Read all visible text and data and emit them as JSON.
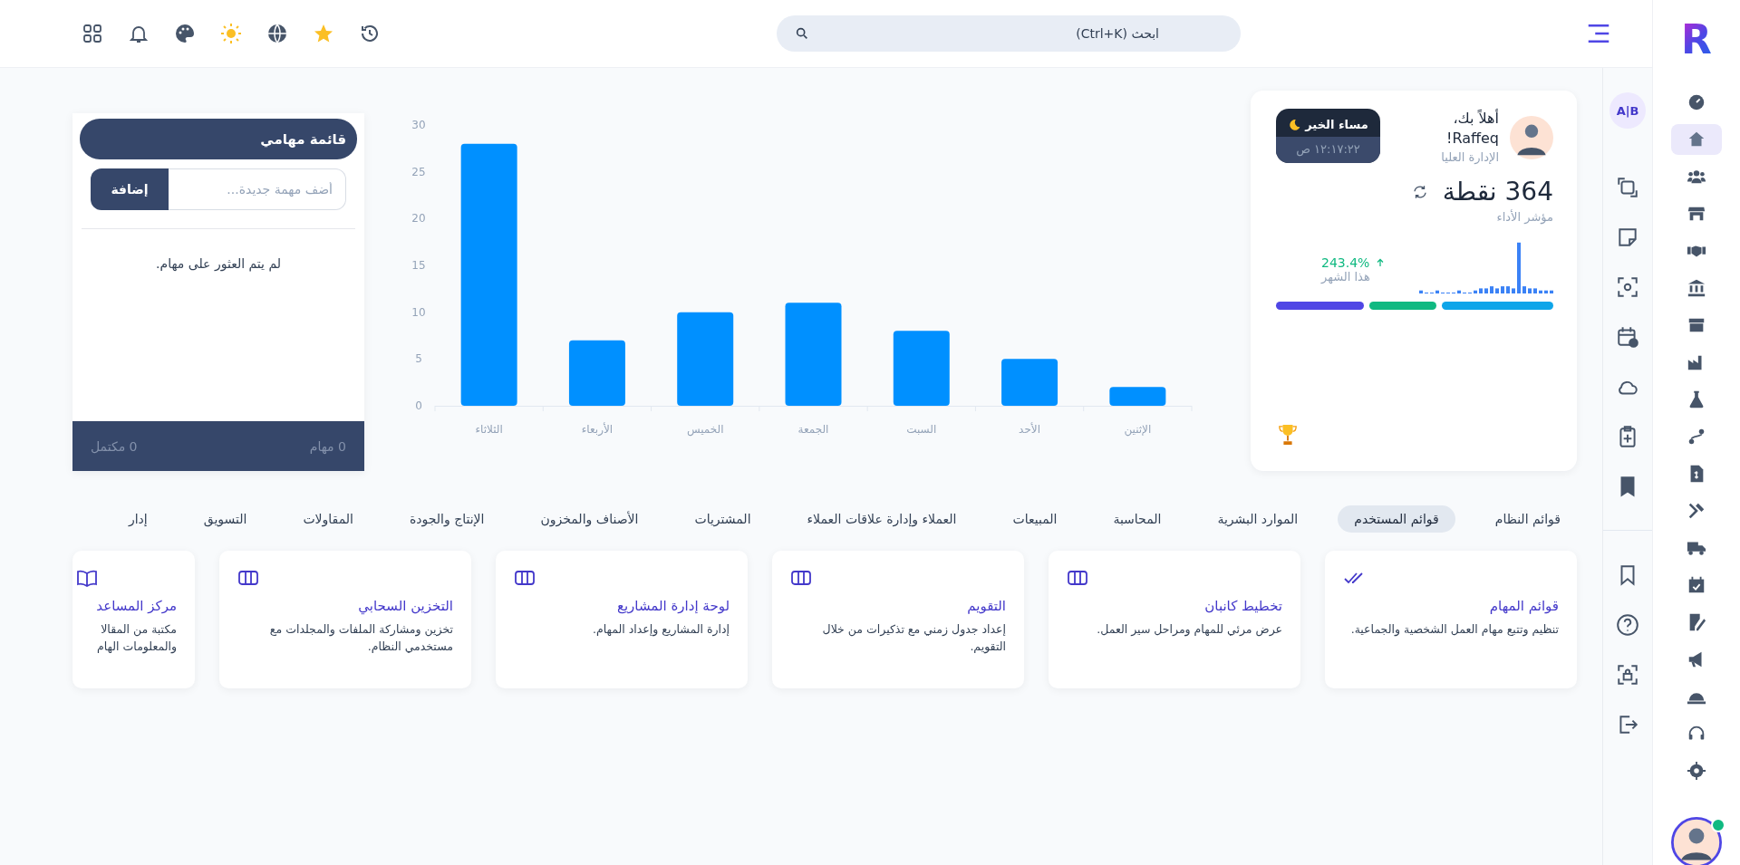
{
  "app_logo": "R",
  "topbar": {
    "search": {
      "placeholder": "ابحث (Ctrl+K)"
    }
  },
  "nav_rail": {
    "items": [
      {
        "selected": false
      },
      {
        "selected": true
      },
      {
        "selected": false
      },
      {
        "selected": false
      },
      {
        "selected": false
      },
      {
        "selected": false
      },
      {
        "selected": false
      },
      {
        "selected": false
      },
      {
        "selected": false
      },
      {
        "selected": false
      },
      {
        "selected": false
      },
      {
        "selected": false
      },
      {
        "selected": false
      },
      {
        "selected": false
      },
      {
        "selected": false
      },
      {
        "selected": false
      },
      {
        "selected": false
      },
      {
        "selected": false
      },
      {
        "selected": false
      }
    ],
    "user": {
      "online": true
    }
  },
  "tool_rail": {
    "badge": "A|B"
  },
  "profile": {
    "greeting": "أهلاً بك،",
    "name": "Raffeq!",
    "role": "الإدارة العليا",
    "period": "مساء الخير",
    "time": "١٢:١٧:٢٢ ص",
    "points": "364 نقطة",
    "points_label": "مؤشر الأداء",
    "change": "243.4%",
    "change_label": "هذا الشهر",
    "segments": [
      {
        "color": "#0ea5e9"
      },
      {
        "color": "#10b981"
      },
      {
        "color": "#4f46e5"
      }
    ]
  },
  "chart": {
    "chart_data": {
      "type": "bar",
      "categories": [
        "الثلاثاء",
        "الأربعاء",
        "الخميس",
        "الجمعة",
        "السبت",
        "الأحد",
        "الإثنين"
      ],
      "values": [
        28,
        7,
        10,
        11,
        8,
        5,
        2
      ],
      "ylim": [
        0,
        30
      ],
      "yticks": [
        0,
        5,
        10,
        15,
        20,
        25,
        30
      ]
    }
  },
  "tasks": {
    "title": "قائمة مهامي",
    "input": {
      "placeholder": "أضف مهمة جديدة..."
    },
    "add_button": "إضافة",
    "empty_text": "لم يتم العثور على مهام.",
    "footer_total": "0 مهام",
    "footer_done": "0 مكتمل"
  },
  "tabs": [
    {
      "label": "قوائم النظام",
      "selected": false
    },
    {
      "label": "قوائم المستخدم",
      "selected": true
    },
    {
      "label": "الموارد البشرية",
      "selected": false
    },
    {
      "label": "المحاسبة",
      "selected": false
    },
    {
      "label": "المبيعات",
      "selected": false
    },
    {
      "label": "العملاء وإدارة علاقات العملاء",
      "selected": false
    },
    {
      "label": "المشتريات",
      "selected": false
    },
    {
      "label": "الأصناف والمخزون",
      "selected": false
    },
    {
      "label": "الإنتاج والجودة",
      "selected": false
    },
    {
      "label": "المقاولات",
      "selected": false
    },
    {
      "label": "التسويق",
      "selected": false
    },
    {
      "label": "إدار",
      "selected": false
    }
  ],
  "apps": [
    {
      "title": "قوائم المهام",
      "description": "تنظيم وتتبع مهام العمل الشخصية والجماعية."
    },
    {
      "title": "تخطيط كانبان",
      "description": "عرض مرئي للمهام ومراحل سير العمل."
    },
    {
      "title": "التقويم",
      "description": "إعداد جدول زمني مع تذكيرات من خلال التقويم."
    },
    {
      "title": "لوحة إدارة المشاريع",
      "description": "إدارة المشاريع وإعداد المهام."
    },
    {
      "title": "التخزين السحابي",
      "description": "تخزين ومشاركة الملفات والمجلدات مع مستخدمي النظام."
    },
    {
      "title": "مركز المساعد",
      "description": "مكتبة من المقالا والمعلومات الهام"
    }
  ]
}
